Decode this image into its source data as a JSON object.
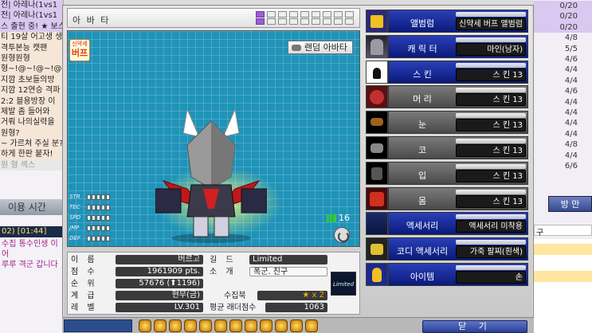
{
  "background": {
    "chat_lines": [
      {
        "text": "전| 아레나(1vs1",
        "style": "hl"
      },
      {
        "text": "전| 아레나(1vs1",
        "style": "hl"
      },
      {
        "text": "스 출현 중! ★ 보스",
        "style": "hl"
      },
      {
        "text": "티 19살 어고생 생",
        "style": "warm"
      },
      {
        "text": "격투본능 캣팬",
        "style": "warm"
      },
      {
        "text": "원형원형",
        "style": "warm"
      },
      {
        "text": "형~!@~!@~!@",
        "style": "warm"
      },
      {
        "text": "지깜 초보들의방",
        "style": "warm"
      },
      {
        "text": "지깜 12연승 격파",
        "style": "warm"
      },
      {
        "text": "2:2 블용방장 이",
        "style": "warm"
      },
      {
        "text": "제발 좀 들어와",
        "style": "warm"
      },
      {
        "text": "거뤄 나의실력을",
        "style": "warm"
      },
      {
        "text": "원형?",
        "style": "warm"
      },
      {
        "text": "~ 가르쳐 주실 분?",
        "style": "warm"
      },
      {
        "text": "하게 한판 붙자!",
        "style": "warm"
      },
      {
        "text": "원 형 섹스",
        "style": "dim"
      }
    ],
    "bar_label": "이용 시간",
    "time_text": "02) [01:44]",
    "news": [
      "수집 통수인생 이어",
      "루루 격군 갑니다"
    ],
    "right_counts": [
      "0/20",
      "0/20",
      "0/20",
      "4/8",
      "5/5",
      "4/6",
      "4/4",
      "4/4",
      "4/6",
      "4/4",
      "4/4",
      "4/4",
      "4/4",
      "4/8",
      "4/4",
      "6/6"
    ],
    "right_button": "방 만",
    "right_small": "구"
  },
  "avatar_panel": {
    "title": "아 바 타",
    "random_button": "랜덤 아바타",
    "buff_badge": {
      "line1": "신약세",
      "line2": "버프"
    },
    "stat_labels": [
      "STR",
      "TEC",
      "SPD",
      "JMP",
      "DEF"
    ],
    "count": "16"
  },
  "info": {
    "name_label": "이 름",
    "name": "버르고",
    "points_label": "점 수",
    "points": "1961909 pts.",
    "rank_label": "순 위",
    "rank": "57676 (⬆1196)",
    "class_label": "계 급",
    "class": "현무(금)",
    "level_label": "레 벨",
    "level": "LV.301",
    "guild_label": "길 드",
    "guild": "Limited",
    "intro_label": "소 개",
    "intro": "폭군. 친구",
    "collection_label": "수집북",
    "collection": "★ x 2",
    "ladder_label": "평균 래더점수",
    "ladder": "1063",
    "guild_logo_text": "Limited"
  },
  "equipment": [
    {
      "name": "앨범럼",
      "value": "신약세 버프 앨범럼",
      "style": "blue",
      "thumb": "t-album"
    },
    {
      "name": "캐 릭 터",
      "value": "마인(남자)",
      "style": "blue",
      "thumb": "t-char"
    },
    {
      "name": "스 킨",
      "value": "스 킨 13",
      "style": "blue",
      "thumb": "t-skin"
    },
    {
      "name": "머 리",
      "value": "스 킨 13",
      "style": "grey",
      "thumb": "t-hair"
    },
    {
      "name": "눈",
      "value": "스 킨 13",
      "style": "grey",
      "thumb": "t-eye"
    },
    {
      "name": "코",
      "value": "스 킨 13",
      "style": "grey",
      "thumb": "t-nose"
    },
    {
      "name": "입",
      "value": "스 킨 13",
      "style": "grey",
      "thumb": "t-mouth"
    },
    {
      "name": "몸",
      "value": "스 킨 13",
      "style": "grey",
      "thumb": "t-body"
    },
    {
      "name": "액세서리",
      "value": "액세서리 미착용",
      "style": "blue",
      "thumb": "t-acc"
    },
    {
      "name": "코디 액세서리",
      "value": "가죽 팔찌(흰색)",
      "style": "blue",
      "thumb": "t-codi"
    },
    {
      "name": "아이템",
      "value": "손",
      "style": "blue",
      "thumb": "t-item"
    }
  ],
  "close_button": "닫 기",
  "colors": {
    "accent": "#1f93b8",
    "blue_bar": "#1a2fa0",
    "purple_slot": "#9b5fd0"
  }
}
